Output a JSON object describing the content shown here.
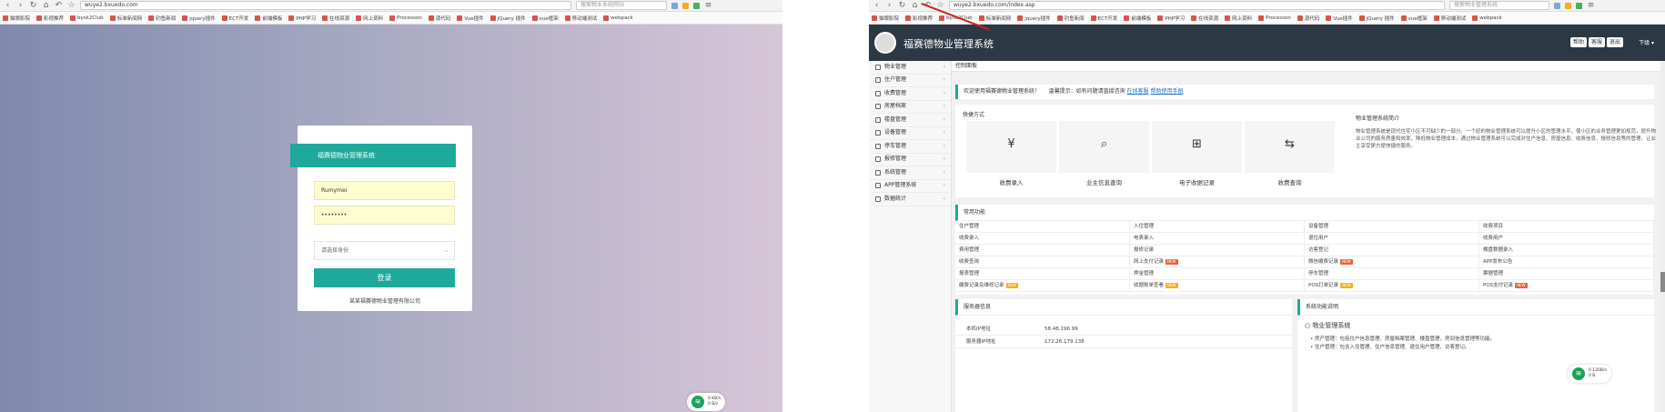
{
  "left": {
    "url": "wuye2.bxuedo.com",
    "search_placeholder": "搜索物业系统网站",
    "bookmarks": [
      "猫眼影院",
      "影视推荐",
      "bysk2Club",
      "标准新闻网",
      "钓鱼新闻",
      "jquery插件",
      "ECT开发",
      "前端模板",
      "PHP学习",
      "在线资源",
      "网上资料",
      "Processon",
      "源代码",
      "Vue插件",
      "jQuery 插件",
      "vue框架",
      "移动端测试",
      "webpack"
    ],
    "login": {
      "title": "福赛德物业管理系统",
      "username": "Rumymei",
      "password": "••••••••",
      "select_placeholder": "请选择身份",
      "submit": "登录",
      "footer": "某某福赛德物业管理有限公司"
    },
    "wifi": {
      "line1": "0 KB/s",
      "line2": "0 B/s"
    }
  },
  "right": {
    "url": "wuye2.bxuedo.com/index.asp",
    "search_placeholder": "搜索物业管理系统",
    "bookmarks": [
      "猫眼影院",
      "影视推荐",
      "bysk2Club",
      "标准新闻网",
      "jquery插件",
      "钓鱼新闻",
      "ECT开发",
      "前端模板",
      "PHP学习",
      "在线资源",
      "网上资料",
      "Processon",
      "源代码",
      "Vue插件",
      "jQuery 插件",
      "vue框架",
      "移动端测试",
      "webpack"
    ],
    "header": {
      "title": "福赛德物业管理系统",
      "buttons": [
        "帮助",
        "客服",
        "退出"
      ],
      "user": "下级"
    },
    "sidebar": [
      "物业管理",
      "住户管理",
      "收费管理",
      "房屋档案",
      "楼盘管理",
      "设备管理",
      "停车管理",
      "报修管理",
      "系统管理",
      "APP管理系统",
      "数据统计"
    ],
    "breadcrumb": "控制面板",
    "welcome": {
      "text": "欢迎使用福赛德物业管理系统！",
      "notice": "温馨提示：如有问题请直接咨询",
      "link1": "在线客服",
      "link2": "帮助使用手册"
    },
    "quick": {
      "title": "快捷方式",
      "items": [
        {
          "icon": "¥",
          "label": "收费录入"
        },
        {
          "icon": "⌕",
          "label": "业主信息查询"
        },
        {
          "icon": "⊞",
          "label": "电子收据记录"
        },
        {
          "icon": "⇆",
          "label": "收费查询"
        }
      ]
    },
    "intro": {
      "title": "物业管理系统简介",
      "text": "物业管理系统是现代住宅小区不可缺少的一部分。一个好的物业管理系统可以提升小区的管理水平，使小区的业务管理更加规范，提升物业公司的服务质量和效率，降低物业管理成本。通过物业管理系统可以完成对住户信息、房屋信息、收费信息、报修信息等的管理，让业主享受更方便快捷的服务。"
    },
    "common": {
      "title": "常用功能",
      "cells": [
        {
          "t": "住户管理"
        },
        {
          "t": "入住管理"
        },
        {
          "t": "设备管理"
        },
        {
          "t": "收费项目"
        },
        {
          "t": "收费录入"
        },
        {
          "t": "电表录入"
        },
        {
          "t": "退住用户"
        },
        {
          "t": "收费用户"
        },
        {
          "t": "费用管理"
        },
        {
          "t": "报修记录"
        },
        {
          "t": "访客登记"
        },
        {
          "t": "楼盘数据录入"
        },
        {
          "t": "收费查询"
        },
        {
          "t": "网上支付记录",
          "b": "NEW",
          "c": "#e8623c"
        },
        {
          "t": "微信缴费记录",
          "b": "NEW",
          "c": "#e8623c"
        },
        {
          "t": "APP发布公告"
        },
        {
          "t": "报表管理"
        },
        {
          "t": "押金管理"
        },
        {
          "t": "停车管理"
        },
        {
          "t": "票据管理"
        },
        {
          "t": "缴费记录及维修记录",
          "b": "NEW",
          "c": "#f0b01d"
        },
        {
          "t": "收据账单查看",
          "b": "NEW",
          "c": "#f0b01d"
        },
        {
          "t": "POS打单记录",
          "b": "NEW",
          "c": "#f0b01d"
        },
        {
          "t": "POS支付记录",
          "b": "NEW",
          "c": "#e8623c"
        }
      ]
    },
    "server": {
      "title": "服务器信息",
      "rows": [
        {
          "k": "本机IP地址",
          "v": "58.48.196.99"
        },
        {
          "k": "服务器IP地址",
          "v": "172.26.179.138"
        }
      ]
    },
    "news": {
      "title": "系统功能说明",
      "heading": "物业管理系统",
      "items": [
        "• 房产管理：包括住户信息管理、房屋档案管理、楼盘管理、房间信息管理等功能。",
        "• 住户管理：包含入住管理、住户信息管理、退住用户管理、访客登记。"
      ]
    },
    "wifi": {
      "line1": "0 120B/s",
      "line2": "0 B"
    }
  }
}
